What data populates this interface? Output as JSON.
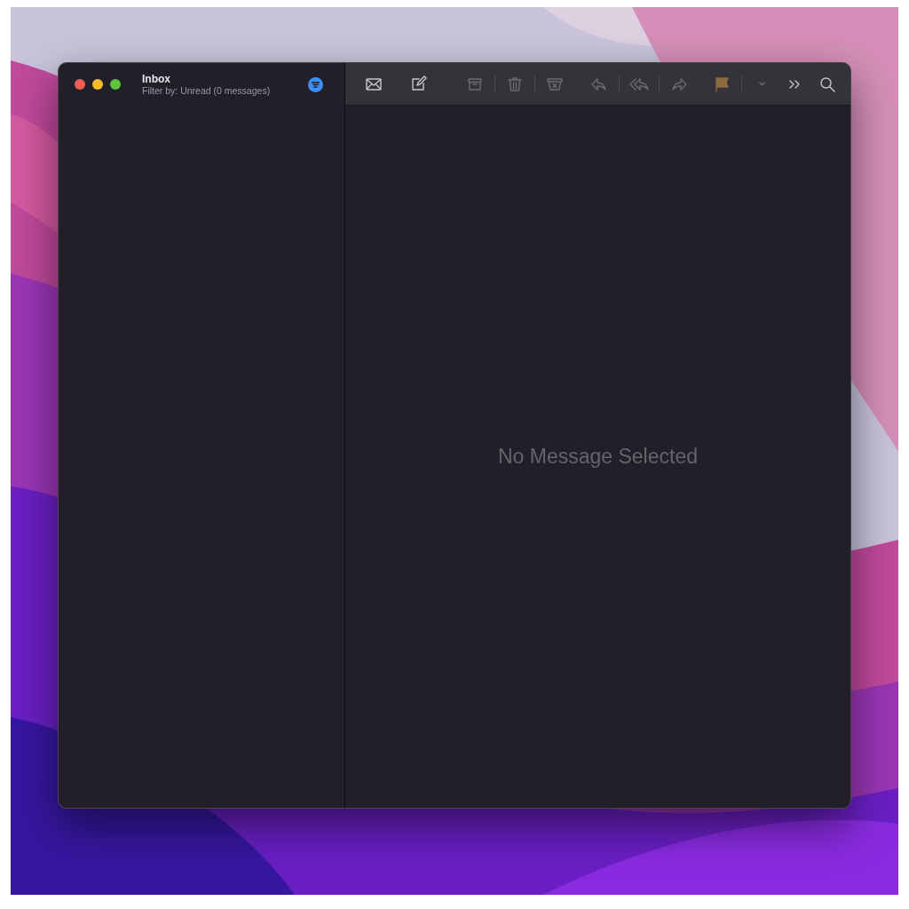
{
  "window": {
    "title": "Inbox",
    "subtitle": "Filter by: Unread (0 messages)",
    "filter_on": true
  },
  "toolbar": [
    {
      "kind": "get-mail",
      "disabled": false
    },
    {
      "kind": "compose",
      "disabled": false
    },
    {
      "kind": "archive",
      "disabled": true
    },
    {
      "kind": "separator"
    },
    {
      "kind": "trash",
      "disabled": true
    },
    {
      "kind": "separator"
    },
    {
      "kind": "junk",
      "disabled": true
    },
    {
      "kind": "reply",
      "disabled": true
    },
    {
      "kind": "separator"
    },
    {
      "kind": "reply-all",
      "disabled": true
    },
    {
      "kind": "separator"
    },
    {
      "kind": "forward",
      "disabled": true
    },
    {
      "kind": "flag",
      "disabled": false
    },
    {
      "kind": "separator"
    },
    {
      "kind": "dropdown",
      "disabled": true
    },
    {
      "kind": "more",
      "disabled": false
    },
    {
      "kind": "search",
      "disabled": false
    }
  ],
  "message_view": {
    "empty_text": "No Message Selected"
  }
}
